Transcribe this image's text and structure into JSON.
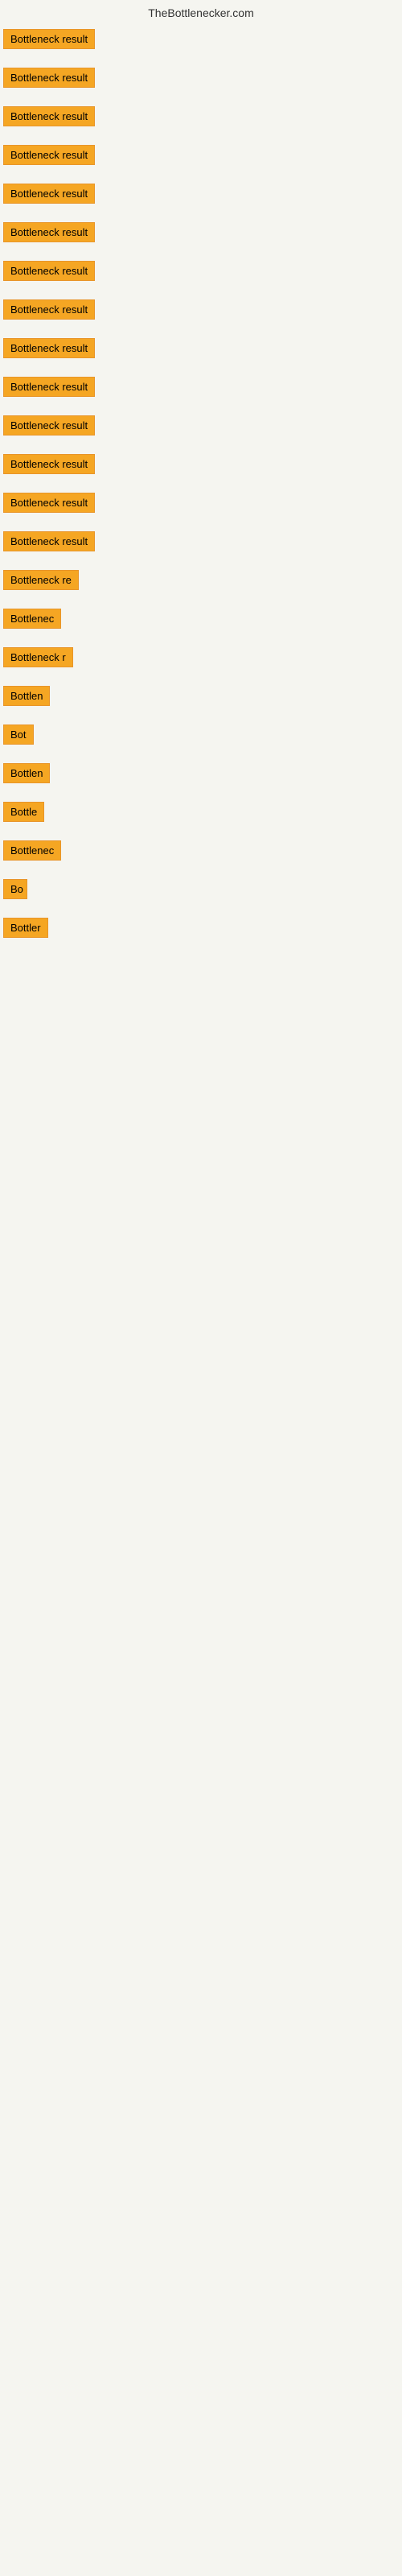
{
  "site": {
    "title": "TheBottlenecker.com"
  },
  "items": [
    {
      "id": 1,
      "label": "Bottleneck result",
      "width": 120
    },
    {
      "id": 2,
      "label": "Bottleneck result",
      "width": 120
    },
    {
      "id": 3,
      "label": "Bottleneck result",
      "width": 120
    },
    {
      "id": 4,
      "label": "Bottleneck result",
      "width": 120
    },
    {
      "id": 5,
      "label": "Bottleneck result",
      "width": 120
    },
    {
      "id": 6,
      "label": "Bottleneck result",
      "width": 120
    },
    {
      "id": 7,
      "label": "Bottleneck result",
      "width": 120
    },
    {
      "id": 8,
      "label": "Bottleneck result",
      "width": 120
    },
    {
      "id": 9,
      "label": "Bottleneck result",
      "width": 120
    },
    {
      "id": 10,
      "label": "Bottleneck result",
      "width": 120
    },
    {
      "id": 11,
      "label": "Bottleneck result",
      "width": 120
    },
    {
      "id": 12,
      "label": "Bottleneck result",
      "width": 120
    },
    {
      "id": 13,
      "label": "Bottleneck result",
      "width": 120
    },
    {
      "id": 14,
      "label": "Bottleneck result",
      "width": 120
    },
    {
      "id": 15,
      "label": "Bottleneck re",
      "width": 100
    },
    {
      "id": 16,
      "label": "Bottlenec",
      "width": 80
    },
    {
      "id": 17,
      "label": "Bottleneck r",
      "width": 88
    },
    {
      "id": 18,
      "label": "Bottlen",
      "width": 68
    },
    {
      "id": 19,
      "label": "Bot",
      "width": 40
    },
    {
      "id": 20,
      "label": "Bottlen",
      "width": 68
    },
    {
      "id": 21,
      "label": "Bottle",
      "width": 58
    },
    {
      "id": 22,
      "label": "Bottlenec",
      "width": 78
    },
    {
      "id": 23,
      "label": "Bo",
      "width": 30
    },
    {
      "id": 24,
      "label": "Bottler",
      "width": 58
    }
  ]
}
